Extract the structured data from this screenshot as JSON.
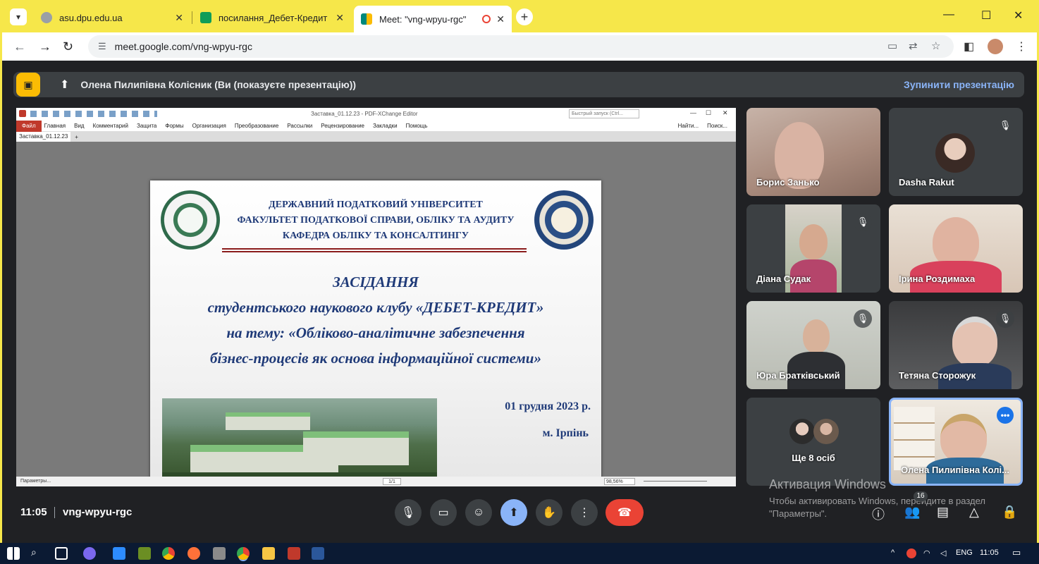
{
  "browser": {
    "tabs": [
      {
        "label": "asu.dpu.edu.ua",
        "favicon_color": "#9aa0a6"
      },
      {
        "label": "посилання_Дебет-Кредит • ко",
        "favicon_color": "#0f9d58"
      },
      {
        "label": "Meet: \"vng-wpyu-rgc\"",
        "favicon_color": "#00897b",
        "active": true
      }
    ],
    "url": "meet.google.com/vng-wpyu-rgc",
    "theme_color": "#f6e74a"
  },
  "presentation_bar": {
    "presenter": "Олена Пилипівна Колісник (Ви (показуєте презентацію))",
    "stop_label": "Зупинити презентацію"
  },
  "pdf_editor": {
    "title": "Заставка_01.12.23 - PDF-XChange Editor",
    "quick_search": "Быстрый запуск (Ctrl...",
    "menu": [
      "Файл",
      "Главная",
      "Вид",
      "Комментарий",
      "Защита",
      "Формы",
      "Организация",
      "Преобразование",
      "Рассылки",
      "Рецензирование",
      "Закладки",
      "Помощь"
    ],
    "search_buttons": [
      "Найти...",
      "Поиск..."
    ],
    "doc_tab": "Заставка_01.12.23",
    "status_left": "Параметры...",
    "page_indicator": "1/1",
    "zoom": "98,56%"
  },
  "slide": {
    "org_lines": [
      "ДЕРЖАВНИЙ ПОДАТКОВИЙ УНІВЕРСИТЕТ",
      "ФАКУЛЬТЕТ ПОДАТКОВОЇ СПРАВИ, ОБЛІКУ ТА АУДИТУ",
      "КАФЕДРА ОБЛІКУ ТА КОНСАЛТИНГУ"
    ],
    "title_lines": [
      "ЗАСІДАННЯ",
      "студентського наукового клубу «ДЕБЕТ-КРЕДИТ»",
      "на тему: «Обліково-аналітичне забезпечення",
      "бізнес-процесів як основа інформаційної системи»"
    ],
    "date": "01 грудня 2023 р.",
    "city": "м. Ірпінь"
  },
  "participants": [
    {
      "name": "Борис Занько",
      "muted": false
    },
    {
      "name": "Dasha Rakut",
      "muted": true
    },
    {
      "name": "Діана Судак",
      "muted": true
    },
    {
      "name": "Ірина Роздимаха",
      "muted": false
    },
    {
      "name": "Юра Братківський",
      "muted": true
    },
    {
      "name": "Тетяна Сторожук",
      "muted": true
    },
    {
      "name": "Ще 8 осіб",
      "muted": false
    },
    {
      "name": "Олена Пилипівна Колі...",
      "muted": false
    }
  ],
  "watermark": {
    "title": "Активация Windows",
    "text": "Чтобы активировать Windows, перейдите в раздел \"Параметры\"."
  },
  "controls": {
    "time": "11:05",
    "meeting_code": "vng-wpyu-rgc",
    "people_count": "16"
  },
  "taskbar": {
    "lang": "ENG",
    "time": "11:05"
  }
}
